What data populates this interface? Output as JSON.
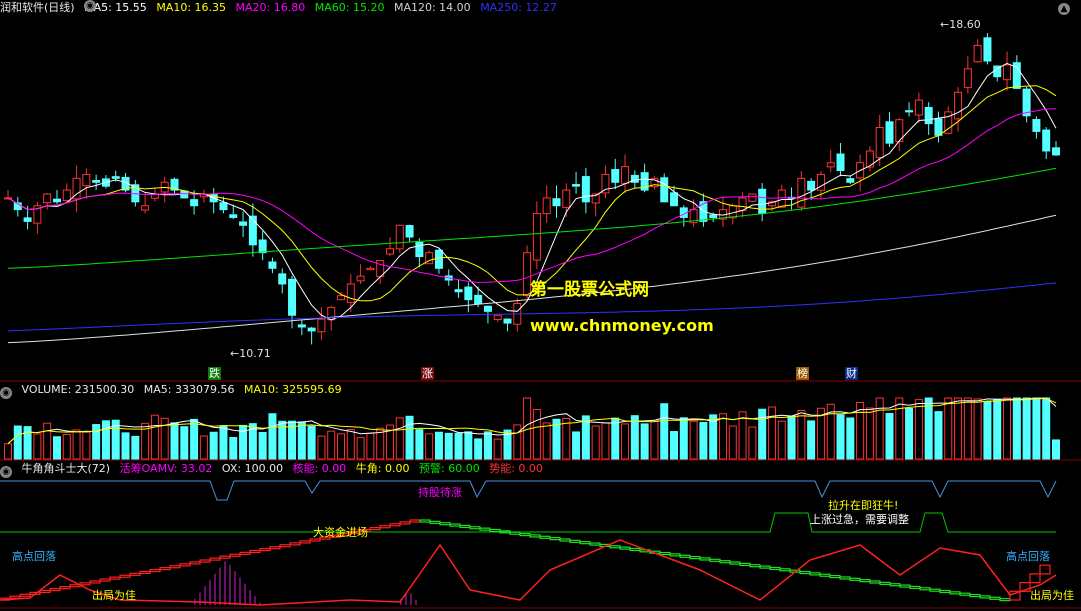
{
  "main_header": {
    "title": "润和软件(日线)",
    "ma5": "MA5: 15.55",
    "ma10": "MA10: 16.35",
    "ma20": "MA20: 16.80",
    "ma60": "MA60: 15.20",
    "ma120": "MA120: 14.00",
    "ma250": "MA250: 12.27"
  },
  "volume_header": {
    "volume": "VOLUME: 231500.30",
    "ma5": "MA5: 333079.56",
    "ma10": "MA10: 325595.69"
  },
  "indicator_header": {
    "name": "牛角角斗士大(72)",
    "oamv": "活筹OAMV: 33.02",
    "ox": "OX: 100.00",
    "core": "核能: 0.00",
    "horn": "牛角: 0.00",
    "alert": "预警: 60.00",
    "power": "势能: 0.00"
  },
  "annotations": {
    "high_price": "18.60",
    "low_price": "10.71",
    "watermark_1": "第一股票公式网",
    "watermark_2": "www.chnmoney.com",
    "tag_die": "跌",
    "tag_zhang": "涨",
    "tag_bang": "榜",
    "tag_cai": "财",
    "hold": "持股待涨",
    "lift": "拉升在即狂牛!",
    "overheat": "上涨过急，需要调整",
    "bigmoney": "大资金进场",
    "top_left": "高点回落",
    "top_right": "高点回落",
    "exit_left": "出局为佳",
    "exit_right": "出局为佳"
  },
  "colors": {
    "up": "#ff3232",
    "down": "#54ffff",
    "ma5": "#ffffff",
    "ma10": "#ffff00",
    "ma20": "#ff00ff",
    "ma60": "#00e600",
    "ma120": "#e0e0e0",
    "ma250": "#3030ff"
  },
  "chart_data": {
    "type": "line",
    "title": "润和软件(日线)",
    "ylim": [
      10.0,
      19.0
    ],
    "series": [
      {
        "name": "MA5",
        "last": 15.55
      },
      {
        "name": "MA10",
        "last": 16.35
      },
      {
        "name": "MA20",
        "last": 16.8
      },
      {
        "name": "MA60",
        "last": 15.2
      },
      {
        "name": "MA120",
        "last": 14.0
      },
      {
        "name": "MA250",
        "last": 12.27
      }
    ],
    "close": [
      14.4,
      14.1,
      13.8,
      14.2,
      14.5,
      14.3,
      14.6,
      14.9,
      15.0,
      14.8,
      14.7,
      14.9,
      14.6,
      14.3,
      14.2,
      14.5,
      14.8,
      14.6,
      14.4,
      14.2,
      14.5,
      14.3,
      14.1,
      13.9,
      13.7,
      13.2,
      13.0,
      12.6,
      12.2,
      11.4,
      11.1,
      11.0,
      11.3,
      11.6,
      11.9,
      12.2,
      12.4,
      12.6,
      12.8,
      13.1,
      13.7,
      13.4,
      12.9,
      13.0,
      12.6,
      12.3,
      12.0,
      11.8,
      11.7,
      11.5,
      11.4,
      11.2,
      11.7,
      13.0,
      14.0,
      14.4,
      14.2,
      14.6,
      14.7,
      14.3,
      14.5,
      15.0,
      14.8,
      15.2,
      14.8,
      14.6,
      14.9,
      14.3,
      14.2,
      13.9,
      14.1,
      13.8,
      13.9,
      14.1,
      14.2,
      14.4,
      14.5,
      14.0,
      14.3,
      14.6,
      14.4,
      14.9,
      14.6,
      15.0,
      15.3,
      15.1,
      14.8,
      15.3,
      15.6,
      16.2,
      15.8,
      16.4,
      16.6,
      16.9,
      16.3,
      16.0,
      16.6,
      17.1,
      17.7,
      18.3,
      17.9,
      17.5,
      17.8,
      17.2,
      16.5,
      16.1,
      15.6,
      15.5
    ],
    "volume_last": 231500.3,
    "volume_ma5": 333079.56,
    "volume_ma10": 325595.69
  }
}
